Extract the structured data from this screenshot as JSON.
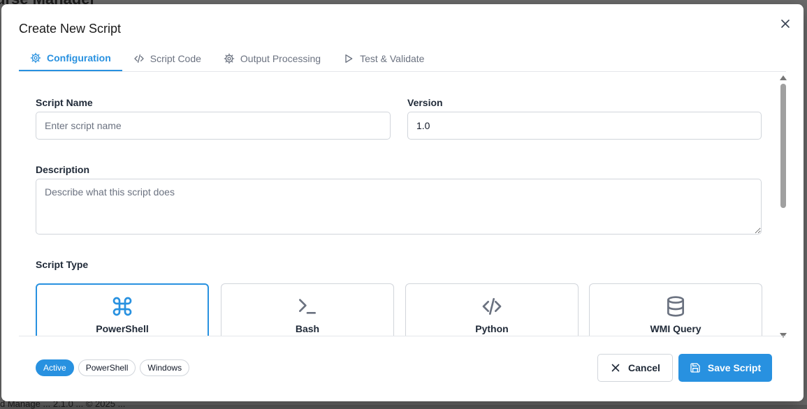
{
  "background": {
    "app_title": "urse Manager",
    "footer_text": "d Manage ... 2.1.0 ... © 2025 ..."
  },
  "modal": {
    "title": "Create New Script",
    "tabs": [
      {
        "label": "Configuration",
        "icon": "gear-icon",
        "active": true
      },
      {
        "label": "Script Code",
        "icon": "code-icon",
        "active": false
      },
      {
        "label": "Output Processing",
        "icon": "gear-icon",
        "active": false
      },
      {
        "label": "Test & Validate",
        "icon": "play-icon",
        "active": false
      }
    ]
  },
  "form": {
    "script_name": {
      "label": "Script Name",
      "placeholder": "Enter script name",
      "value": ""
    },
    "version": {
      "label": "Version",
      "value": "1.0"
    },
    "description": {
      "label": "Description",
      "placeholder": "Describe what this script does",
      "value": ""
    },
    "script_type": {
      "label": "Script Type",
      "options": [
        {
          "name": "PowerShell",
          "icon": "command-icon",
          "selected": true
        },
        {
          "name": "Bash",
          "icon": "terminal-icon",
          "selected": false
        },
        {
          "name": "Python",
          "icon": "code-icon",
          "selected": false
        },
        {
          "name": "WMI Query",
          "icon": "database-icon",
          "selected": false
        }
      ]
    }
  },
  "footer": {
    "badges": [
      "Active",
      "PowerShell",
      "Windows"
    ],
    "cancel_label": "Cancel",
    "save_label": "Save Script"
  },
  "colors": {
    "accent": "#2891e0",
    "border": "#d1d5db",
    "muted_text": "#6b7280"
  }
}
